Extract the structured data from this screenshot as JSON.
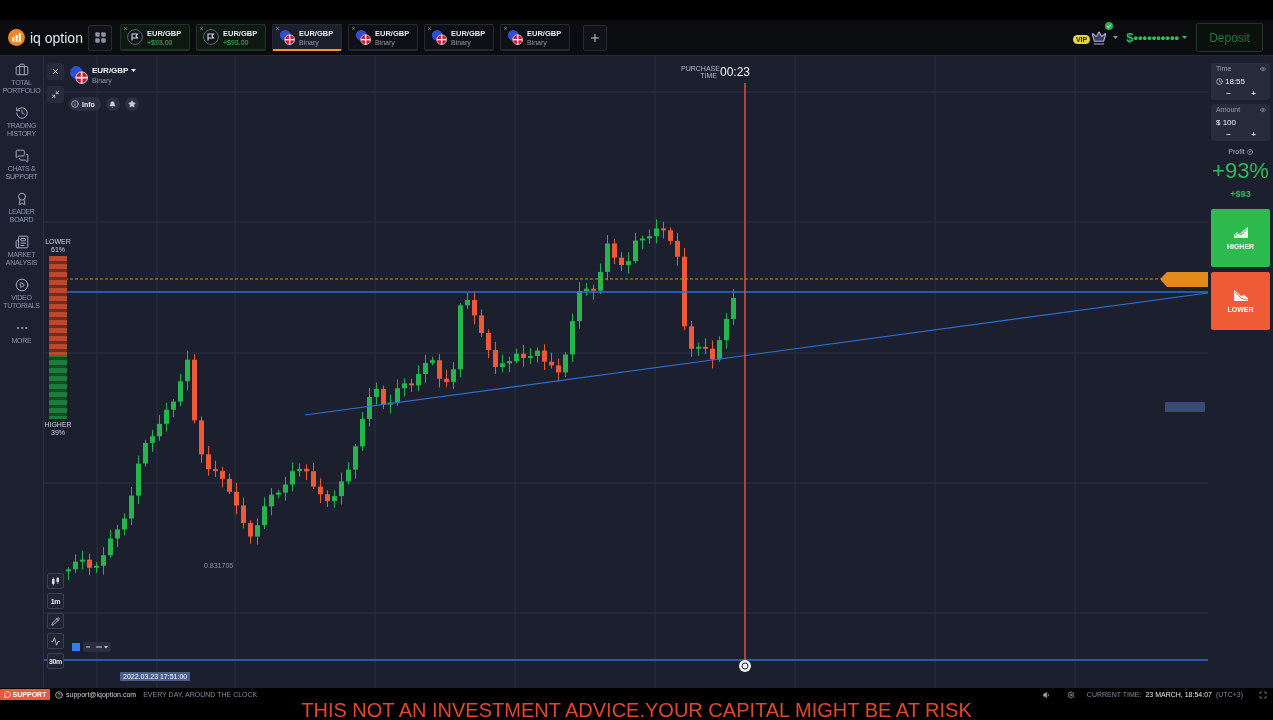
{
  "header": {
    "logo": "iq option",
    "tabs": [
      {
        "kind": "deal",
        "label": "EUR/GBP",
        "detail": "+$93.00",
        "selected": false
      },
      {
        "kind": "deal",
        "label": "EUR/GBP",
        "detail": "+$93.00",
        "selected": false
      },
      {
        "kind": "asset",
        "label": "EUR/GBP",
        "detail": "Binary",
        "selected": true
      },
      {
        "kind": "asset",
        "label": "EUR/GBP",
        "detail": "Binary",
        "selected": false
      },
      {
        "kind": "asset",
        "label": "EUR/GBP",
        "detail": "Binary",
        "selected": false
      },
      {
        "kind": "asset",
        "label": "EUR/GBP",
        "detail": "Binary",
        "selected": false
      }
    ],
    "vip_badge": "VIP",
    "balance": "$••••••••••",
    "deposit_button": "Deposit"
  },
  "sidebar": {
    "items": [
      {
        "label": "TOTAL PORTFOLIO"
      },
      {
        "label": "TRADING HISTORY"
      },
      {
        "label": "CHATS & SUPPORT"
      },
      {
        "label": "LEADER BOARD"
      },
      {
        "label": "MARKET ANALYSIS"
      },
      {
        "label": "VIDEO TUTORIALS"
      },
      {
        "label": "MORE"
      }
    ]
  },
  "chart": {
    "asset": {
      "name": "EUR/GBP",
      "type": "Binary"
    },
    "info_button": "Info",
    "purchase_time": {
      "label": "PURCHASE TIME",
      "countdown": "00:23"
    },
    "sentiment": {
      "lower_label": "LOWER",
      "lower_percent": "61%",
      "higher_label": "HIGHER",
      "higher_percent": "39%",
      "level": 0.61
    },
    "low_price": "0.831705",
    "time_marker": "2022.03.23 17:51:00",
    "tools": [
      {
        "kind": "candles"
      },
      {
        "kind": "interval",
        "label": "1m"
      },
      {
        "kind": "draw"
      },
      {
        "kind": "indicators"
      },
      {
        "kind": "interval",
        "label": "30m"
      }
    ]
  },
  "trade_panel": {
    "time": {
      "label": "Time",
      "value": "18:55",
      "decrease": "−",
      "increase": "+"
    },
    "amount": {
      "label": "Amount",
      "value": "$ 100",
      "decrease": "−",
      "increase": "+"
    },
    "profit": {
      "label": "Profit",
      "percent": "+93%",
      "payout": "+$93"
    },
    "buttons": [
      {
        "kind": "higher",
        "label": "HIGHER"
      },
      {
        "kind": "lower",
        "label": "LOWER"
      }
    ]
  },
  "footer": {
    "support_button": "SUPPORT",
    "email": "support@iqoption.com",
    "hours": "EVERY DAY, AROUND THE CLOCK",
    "current_time_label": "CURRENT TIME:",
    "current_time": "23 MARCH, 18:54:07",
    "timezone": "(UTC+3)"
  },
  "disclaimer": "THIS NOT AN INVESTMENT ADVICE.YOUR CAPITAL MIGHT BE AT RISK"
}
